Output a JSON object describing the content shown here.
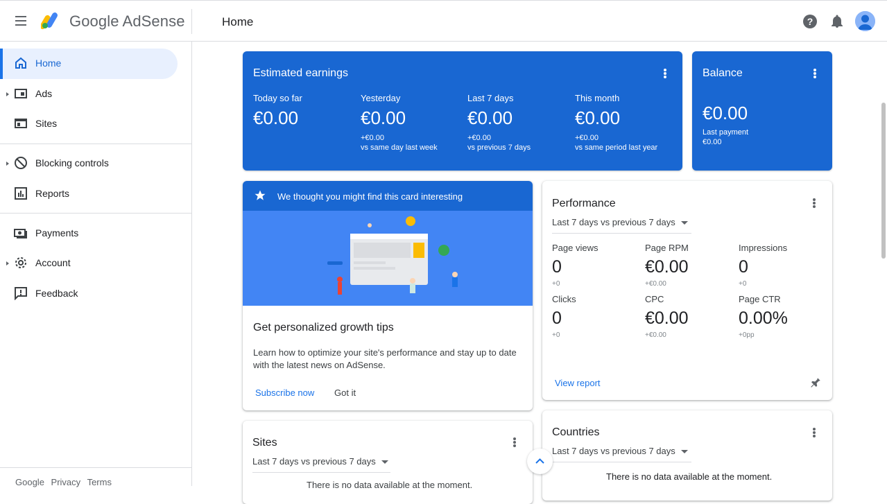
{
  "header": {
    "brand": "Google AdSense",
    "page_title": "Home"
  },
  "sidebar": {
    "items": [
      {
        "label": "Home",
        "icon": "home-icon"
      },
      {
        "label": "Ads",
        "icon": "ads-icon"
      },
      {
        "label": "Sites",
        "icon": "sites-icon"
      },
      {
        "label": "Blocking controls",
        "icon": "block-icon"
      },
      {
        "label": "Reports",
        "icon": "reports-icon"
      },
      {
        "label": "Payments",
        "icon": "payments-icon"
      },
      {
        "label": "Account",
        "icon": "gear-icon"
      },
      {
        "label": "Feedback",
        "icon": "feedback-icon"
      }
    ],
    "footer": [
      "Google",
      "Privacy",
      "Terms"
    ]
  },
  "earnings": {
    "title": "Estimated earnings",
    "metrics": [
      {
        "label": "Today so far",
        "value": "€0.00",
        "delta": "",
        "compare": ""
      },
      {
        "label": "Yesterday",
        "value": "€0.00",
        "delta": "+€0.00",
        "compare": "vs same day last week"
      },
      {
        "label": "Last 7 days",
        "value": "€0.00",
        "delta": "+€0.00",
        "compare": "vs previous 7 days"
      },
      {
        "label": "This month",
        "value": "€0.00",
        "delta": "+€0.00",
        "compare": "vs same period last year"
      }
    ]
  },
  "balance": {
    "title": "Balance",
    "value": "€0.00",
    "last_payment_label": "Last payment",
    "last_payment_value": "€0.00"
  },
  "tips": {
    "banner": "We thought you might find this card interesting",
    "title": "Get personalized growth tips",
    "body": "Learn how to optimize your site's performance and stay up to date with the latest news on AdSense.",
    "subscribe": "Subscribe now",
    "dismiss": "Got it"
  },
  "performance": {
    "title": "Performance",
    "range": "Last 7 days vs previous 7 days",
    "metrics": [
      {
        "label": "Page views",
        "value": "0",
        "delta": "+0"
      },
      {
        "label": "Page RPM",
        "value": "€0.00",
        "delta": "+€0.00"
      },
      {
        "label": "Impressions",
        "value": "0",
        "delta": "+0"
      },
      {
        "label": "Clicks",
        "value": "0",
        "delta": "+0"
      },
      {
        "label": "CPC",
        "value": "€0.00",
        "delta": "+€0.00"
      },
      {
        "label": "Page CTR",
        "value": "0.00%",
        "delta": "+0pp"
      }
    ],
    "view_report": "View report"
  },
  "sites_card": {
    "title": "Sites",
    "range": "Last 7 days vs previous 7 days",
    "empty": "There is no data available at the moment."
  },
  "countries_card": {
    "title": "Countries",
    "range": "Last 7 days vs previous 7 days",
    "empty": "There is no data available at the moment."
  },
  "colors": {
    "primary": "#1967d2",
    "accent_link": "#1a73e8",
    "illustration_bg": "#4285f4"
  }
}
